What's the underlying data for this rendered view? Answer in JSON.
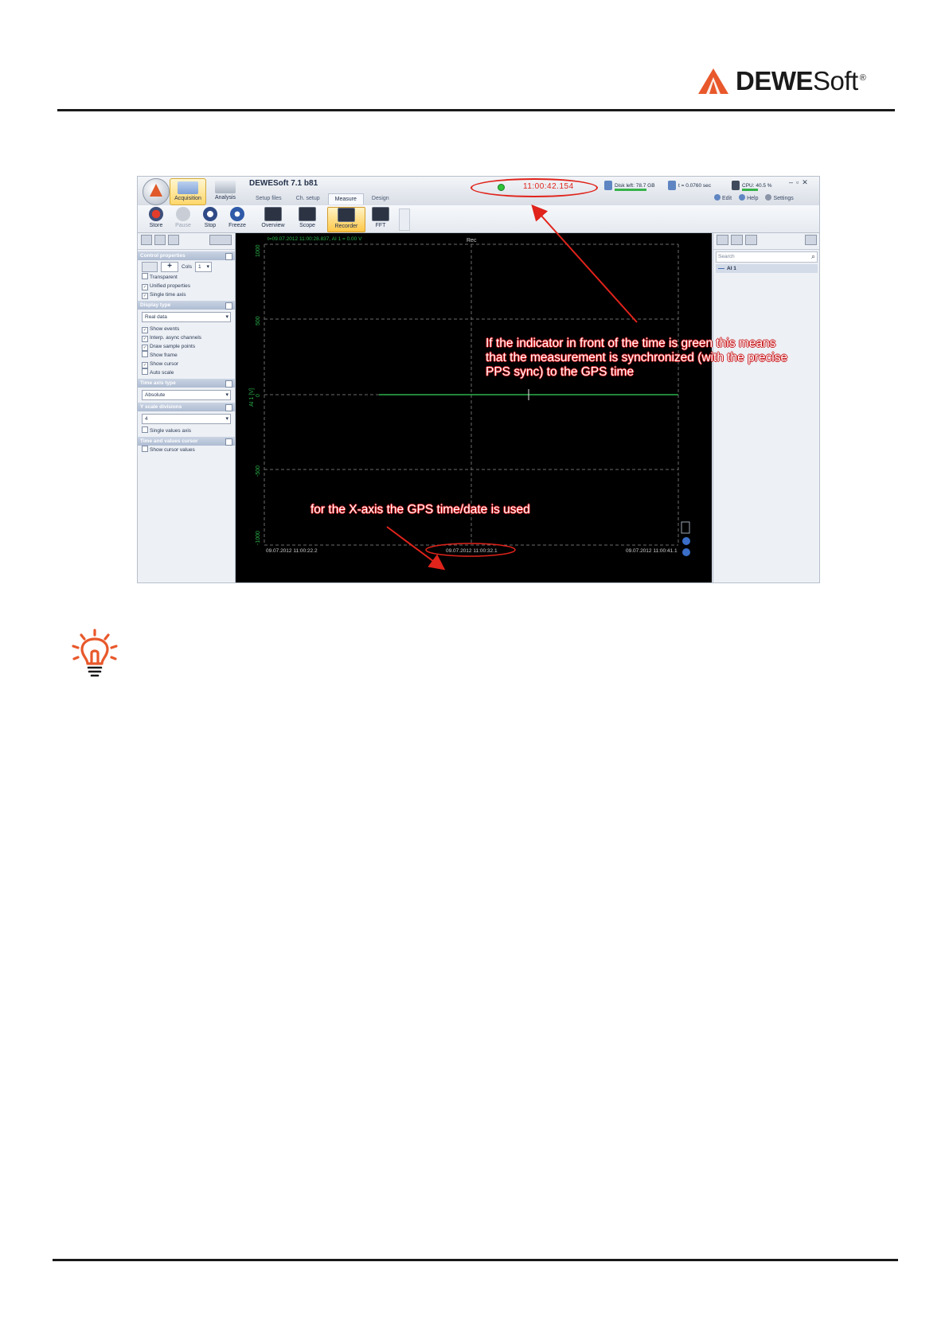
{
  "header": {
    "brand_bold": "DEWE",
    "brand_light": "Soft",
    "registered": "®"
  },
  "screenshot": {
    "app_title": "DEWESoft 7.1 b81",
    "modes": [
      "Acquisition",
      "Analysis"
    ],
    "tabs": [
      "Setup files",
      "Ch. setup",
      "Measure",
      "Design"
    ],
    "active_tab": "Measure",
    "clock": "11:00:42.154",
    "sync_indicator_color": "#2fc43a",
    "status": {
      "disk_left": "Disk left: 78.7 GB",
      "time": "t = 0.0760 sec",
      "cpu": "CPU: 40.5 %"
    },
    "right_links": [
      "Edit",
      "Help",
      "Settings"
    ],
    "ribbon": {
      "store": "Store",
      "pause": "Pause",
      "stop": "Stop",
      "freeze": "Freeze",
      "overview": "Overview",
      "scope": "Scope",
      "recorder": "Recorder",
      "fft": "FFT"
    },
    "left_panel": {
      "control_properties": "Control properties",
      "cols_label": "Cols",
      "cols_value": "1",
      "transparent": "Transparent",
      "unified_properties": "Unified properties",
      "single_time_axis": "Single time axis",
      "display_type": "Display type",
      "display_type_value": "Real data",
      "show_events": "Show events",
      "interp_async": "Interp. async channels",
      "draw_sample_points": "Draw sample points",
      "show_frame": "Show frame",
      "show_cursor": "Show cursor",
      "auto_scale": "Auto scale",
      "time_axis_type": "Time axis type",
      "time_axis_value": "Absolute",
      "y_scale_divisions": "Y scale divisions",
      "y_scale_value": "4",
      "single_values_axis": "Single values axis",
      "time_and_values_cursor": "Time and values cursor",
      "show_cursor_values": "Show cursor values"
    },
    "plot": {
      "header_readout": "t=09.07.2012 11:00:28.837, AI 1 = 0.00 V",
      "rec_label": "Rec",
      "y_axis_title": "AI 1 [V]",
      "y_ticks": [
        "1000",
        "500",
        "0",
        "-500",
        "-1000"
      ],
      "x_ticks": [
        "09.07.2012 11:00:22.2",
        "09.07.2012 11:00:32.1",
        "09.07.2012 11:00:41.1"
      ],
      "trace_color": "#2bb34a"
    },
    "right_panel": {
      "search_placeholder": "Search",
      "channel": "AI 1"
    }
  },
  "annotations": {
    "sync_note": "If the indicator in front of the time is green this means that the measurement is synchronized (with the precise PPS sync) to the GPS time",
    "x_axis_note": "for the X-axis the GPS time/date is used",
    "color": "#e0231b"
  },
  "tip_icon": "lightbulb-icon"
}
